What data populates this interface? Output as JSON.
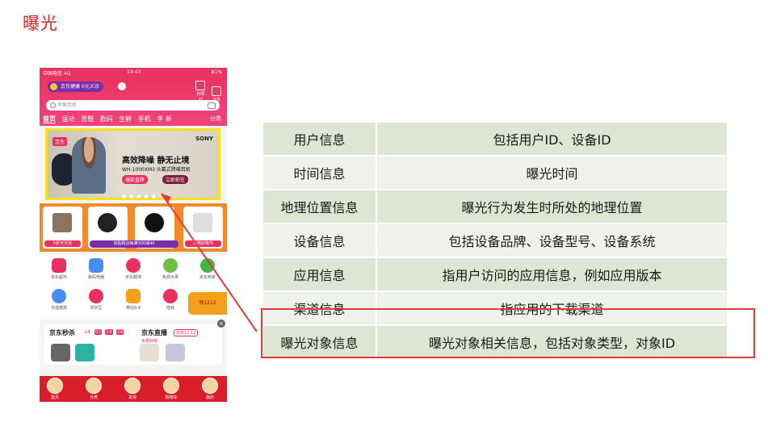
{
  "slide": {
    "title": "曝光"
  },
  "phone": {
    "status": {
      "carrier": "中国电信 4G",
      "time": "14:43",
      "battery": "81%"
    },
    "promo_pill": "京东健康 0元义诊",
    "top_icons": [
      "扫啊扫",
      "消息"
    ],
    "search_placeholder": "苹果耳机",
    "nav": [
      "首页",
      "运动",
      "男鞋",
      "数码",
      "生鲜",
      "手机",
      "手 新"
    ],
    "nav_category": "分类",
    "banner": {
      "tag": "京东",
      "brand": "SONY",
      "headline": "高效降噪 静无止境",
      "subline": "WH-1000XM3 头戴式降噪耳机",
      "btn_left": "爆款直降",
      "btn_right": "立即前往",
      "dots": "● ● ● ● ●"
    },
    "strip": {
      "left_label": "5折天天抢",
      "mid_label": "京贴跨店每满300减40",
      "right_label": "家电好物节"
    },
    "grid_row1": [
      "京东超市",
      "数码电器",
      "京东服饰",
      "免费水果",
      "京东到家"
    ],
    "grid_row2": [
      "充值缴费",
      "领京豆",
      "券后9.9",
      "借钱"
    ],
    "grid_float": "领1212",
    "flash": {
      "title": "京东秒杀",
      "hour": "14",
      "countdown": [
        "01",
        "14",
        "29"
      ],
      "live_title": "京东直播",
      "live_sub": "实惠好物",
      "live_badge": "狂欢12.12"
    },
    "tabbar": [
      "首页",
      "分类",
      "发现",
      "购物车",
      "我的"
    ]
  },
  "info_table": {
    "rows": [
      {
        "label": "用户信息",
        "desc": "包括用户ID、设备ID"
      },
      {
        "label": "时间信息",
        "desc": "曝光时间"
      },
      {
        "label": "地理位置信息",
        "desc": "曝光行为发生时所处的地理位置"
      },
      {
        "label": "设备信息",
        "desc": "包括设备品牌、设备型号、设备系统"
      },
      {
        "label": "应用信息",
        "desc": "指用户访问的应用信息，例如应用版本"
      },
      {
        "label": "渠道信息",
        "desc": "指应用的下载渠道"
      },
      {
        "label": "曝光对象信息",
        "desc": "曝光对象相关信息，包括对象类型，对象ID"
      }
    ],
    "highlighted_row": "曝光对象信息"
  },
  "colors": {
    "title_red": "#e02020",
    "jd_pink": "#e8315e",
    "banner_highlight": "#f5e21d",
    "table_dark": "#dde6d4",
    "table_light": "#eef2ea",
    "highlight_box": "#e03a3a"
  }
}
